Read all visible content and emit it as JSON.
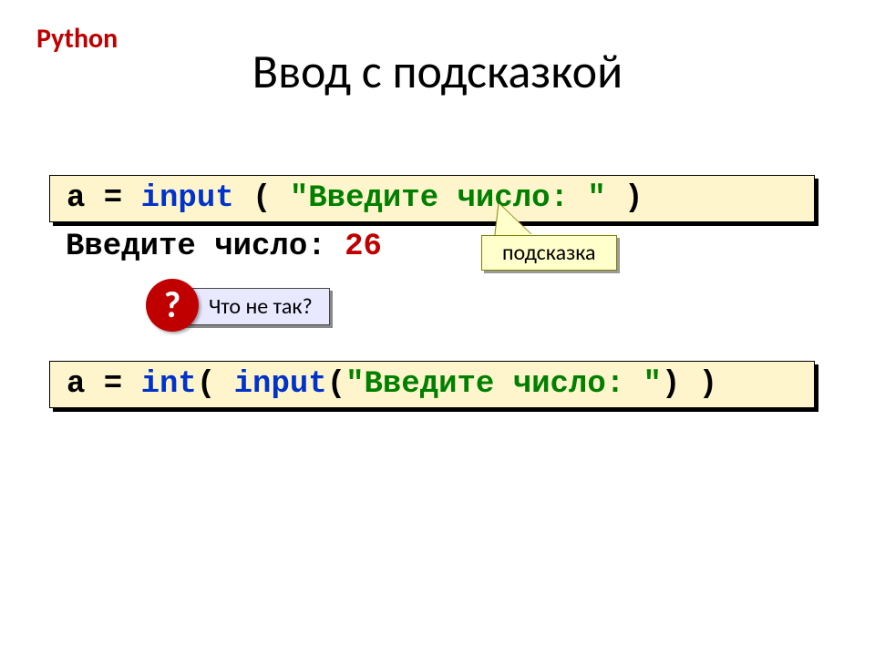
{
  "corner_label": "Python",
  "title": "Ввод с подсказкой",
  "code1": {
    "p1": "a = ",
    "kw": "input",
    "p2": " ( ",
    "str": "\"Введите число: \"",
    "p3": " )"
  },
  "output": {
    "prompt": "Введите число: ",
    "value": "26"
  },
  "hint_label": "подсказка",
  "question_mark": "?",
  "question_text": "Что не так?",
  "code2": {
    "p1": "a = ",
    "kw1": "int",
    "p2": "( ",
    "kw2": "input",
    "p3": "(",
    "str": "\"Введите число: \"",
    "p4": ") )"
  }
}
